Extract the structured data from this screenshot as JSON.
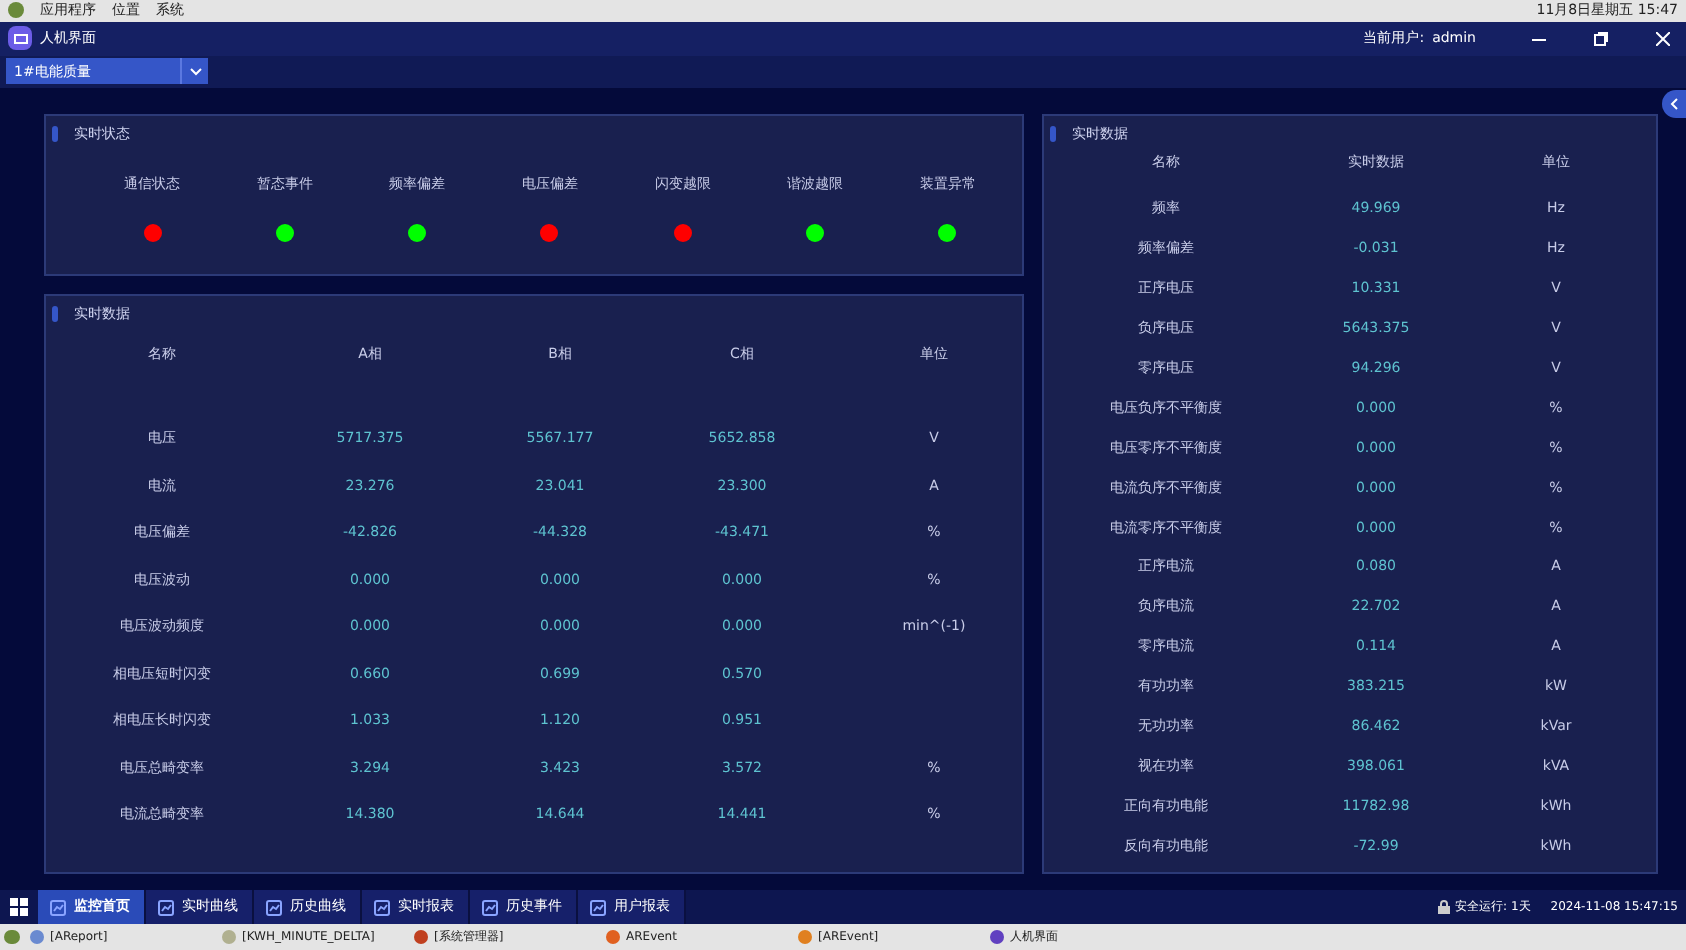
{
  "system_bar": {
    "menus": [
      "应用程序",
      "位置",
      "系统"
    ],
    "clock": "11月8日星期五 15:47"
  },
  "window": {
    "title": "人机界面",
    "user_label": "当前用户:",
    "user": "admin"
  },
  "device_select": {
    "value": "1#电能质量"
  },
  "status_panel": {
    "title": "实时状态",
    "items": [
      {
        "label": "通信状态",
        "color": "#ff0000"
      },
      {
        "label": "暂态事件",
        "color": "#00ff00"
      },
      {
        "label": "频率偏差",
        "color": "#00ff00"
      },
      {
        "label": "电压偏差",
        "color": "#ff0000"
      },
      {
        "label": "闪变越限",
        "color": "#ff0000"
      },
      {
        "label": "谐波越限",
        "color": "#00ff00"
      },
      {
        "label": "装置异常",
        "color": "#00ff00"
      }
    ]
  },
  "phase_panel": {
    "title": "实时数据",
    "columns": [
      "名称",
      "A相",
      "B相",
      "C相",
      "单位"
    ],
    "rows": [
      [
        "电压",
        "5717.375",
        "5567.177",
        "5652.858",
        "V"
      ],
      [
        "电流",
        "23.276",
        "23.041",
        "23.300",
        "A"
      ],
      [
        "电压偏差",
        "-42.826",
        "-44.328",
        "-43.471",
        "%"
      ],
      [
        "电压波动",
        "0.000",
        "0.000",
        "0.000",
        "%"
      ],
      [
        "电压波动频度",
        "0.000",
        "0.000",
        "0.000",
        "min^(-1)"
      ],
      [
        "相电压短时闪变",
        "0.660",
        "0.699",
        "0.570",
        ""
      ],
      [
        "相电压长时闪变",
        "1.033",
        "1.120",
        "0.951",
        ""
      ],
      [
        "电压总畸变率",
        "3.294",
        "3.423",
        "3.572",
        "%"
      ],
      [
        "电流总畸变率",
        "14.380",
        "14.644",
        "14.441",
        "%"
      ]
    ]
  },
  "total_panel": {
    "title": "实时数据",
    "columns": [
      "名称",
      "实时数据",
      "单位"
    ],
    "rows": [
      [
        "频率",
        "49.969",
        "Hz"
      ],
      [
        "频率偏差",
        "-0.031",
        "Hz"
      ],
      [
        "正序电压",
        "10.331",
        "V"
      ],
      [
        "负序电压",
        "5643.375",
        "V"
      ],
      [
        "零序电压",
        "94.296",
        "V"
      ],
      [
        "电压负序不平衡度",
        "0.000",
        "%"
      ],
      [
        "电压零序不平衡度",
        "0.000",
        "%"
      ],
      [
        "电流负序不平衡度",
        "0.000",
        "%"
      ],
      [
        "电流零序不平衡度",
        "0.000",
        "%"
      ],
      [
        "正序电流",
        "0.080",
        "A"
      ],
      [
        "负序电流",
        "22.702",
        "A"
      ],
      [
        "零序电流",
        "0.114",
        "A"
      ],
      [
        "有功功率",
        "383.215",
        "kW"
      ],
      [
        "无功功率",
        "86.462",
        "kVar"
      ],
      [
        "视在功率",
        "398.061",
        "kVA"
      ],
      [
        "正向有功电能",
        "11782.98",
        "kWh"
      ],
      [
        "反向有功电能",
        "-72.99",
        "kWh"
      ]
    ]
  },
  "nav_tabs": [
    {
      "label": "监控首页",
      "selected": true
    },
    {
      "label": "实时曲线",
      "selected": false
    },
    {
      "label": "历史曲线",
      "selected": false
    },
    {
      "label": "实时报表",
      "selected": false
    },
    {
      "label": "历史事件",
      "selected": false
    },
    {
      "label": "用户报表",
      "selected": false
    }
  ],
  "status_bar": {
    "uptime": "安全运行: 1天",
    "datetime": "2024-11-08 15:47:15"
  },
  "taskbar": [
    "[AReport]",
    "[KWH_MINUTE_DELTA]",
    "[系统管理器]",
    "AREvent",
    "[AREvent]",
    "人机界面"
  ]
}
